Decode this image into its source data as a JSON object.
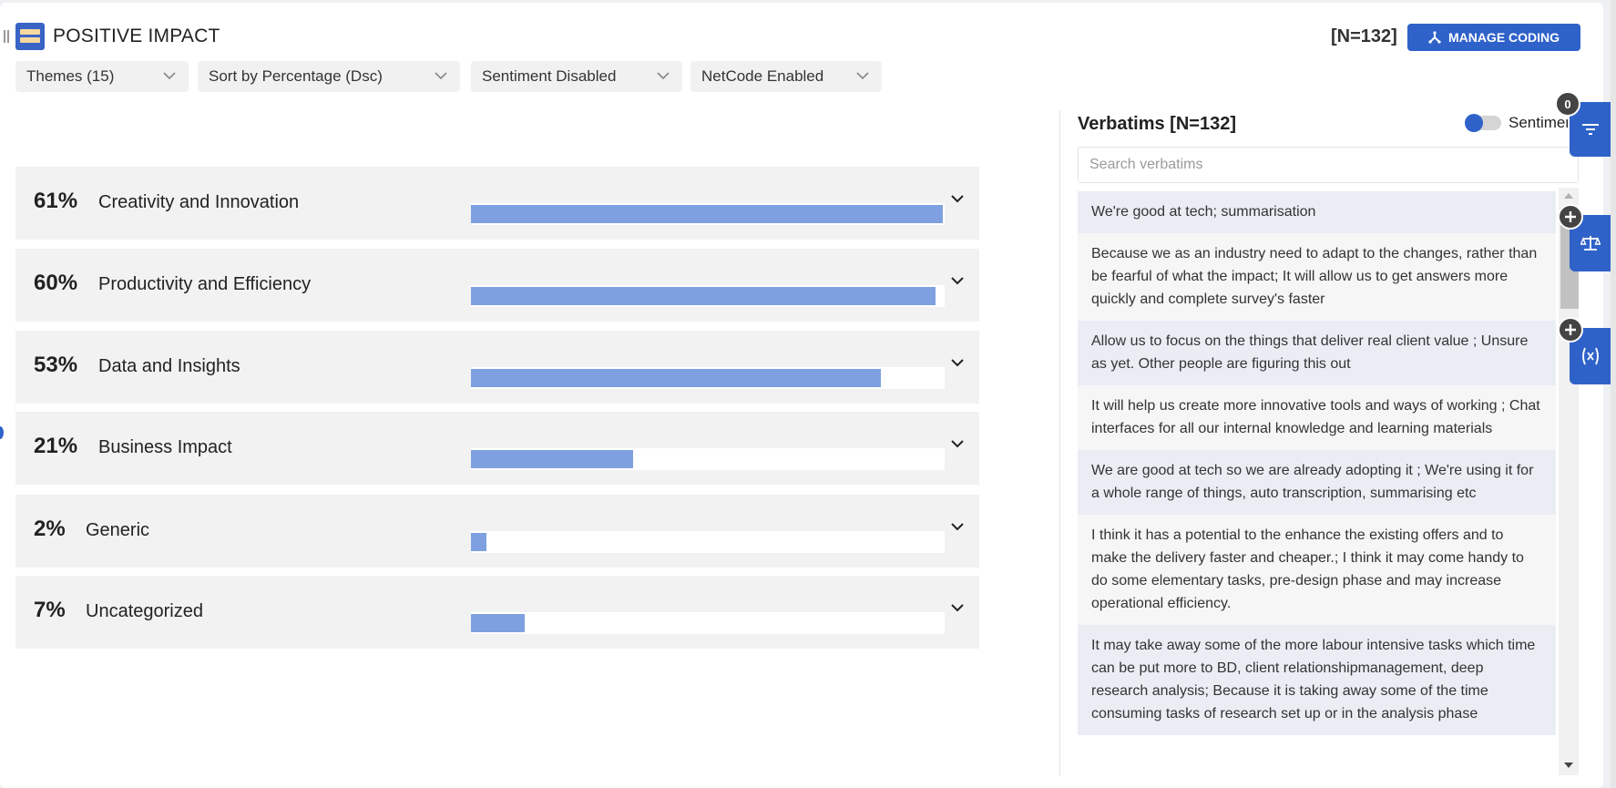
{
  "header": {
    "title": "POSITIVE IMPACT",
    "count": "[N=132]",
    "manage_label": "MANAGE CODING"
  },
  "filters": {
    "themes": "Themes (15)",
    "sort": "Sort by Percentage (Dsc)",
    "sentiment": "Sentiment Disabled",
    "netcode": "NetCode Enabled"
  },
  "themes": [
    {
      "pct": "61%",
      "label": "Creativity and Innovation",
      "value": 61
    },
    {
      "pct": "60%",
      "label": "Productivity and Efficiency",
      "value": 60
    },
    {
      "pct": "53%",
      "label": "Data and Insights",
      "value": 53
    },
    {
      "pct": "21%",
      "label": "Business Impact",
      "value": 21
    },
    {
      "pct": "2%",
      "label": "Generic",
      "value": 2
    },
    {
      "pct": "7%",
      "label": "Uncategorized",
      "value": 7
    }
  ],
  "verbatims": {
    "title": "Verbatims [N=132]",
    "toggle_label": "Sentiment",
    "search_placeholder": "Search verbatims",
    "items": [
      "We're good at tech; summarisation",
      "Because we as an industry need to adapt to the changes, rather than be fearful of what the impact; It will allow us to get answers more quickly and complete survey's faster",
      "Allow us to focus on the things that deliver real client value ; Unsure as yet. Other people are figuring this out",
      "It will help us create more innovative tools and ways of working ; Chat interfaces for all our internal knowledge and learning materials",
      "We are good at tech so we are already adopting it ; We're using it for a whole range of things, auto transcription, summarising etc",
      "I think it has a potential to the enhance the existing offers and to make the delivery faster and cheaper.; I think it may come handy to do some elementary tasks, pre-design phase and may increase operational efficiency.",
      "It may take away some of the more labour intensive tasks which time can be put more to BD, client relationshipmanagement, deep research analysis; Because it is taking away some of the time consuming tasks of research set up or in the analysis phase"
    ]
  },
  "side_panel": {
    "filter_badge": "0"
  }
}
